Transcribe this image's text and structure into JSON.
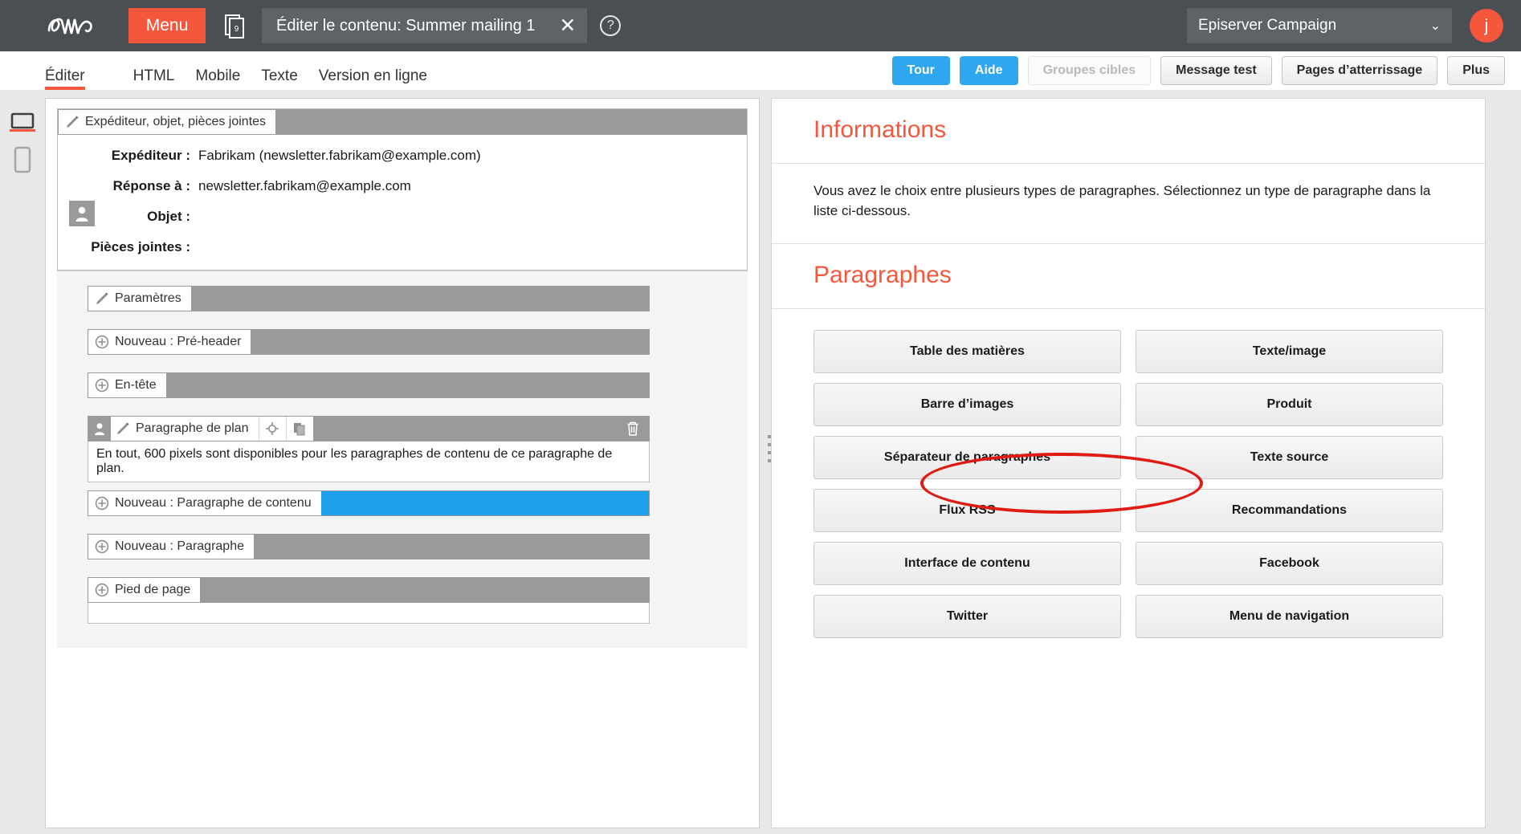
{
  "topbar": {
    "logo_name": "episerver-logo",
    "menu_label": "Menu",
    "doc_icon_badge": "9",
    "tab_title": "Éditer le contenu: Summer mailing 1",
    "tab_close": "✕",
    "help_label": "?",
    "account_label": "Episerver Campaign",
    "account_chevron": "⌄",
    "avatar_initial": "j",
    "accent_color": "#f4573b",
    "bar_color": "#4a4f54"
  },
  "subnav": {
    "tabs": [
      {
        "label": "Éditer",
        "active": true
      },
      {
        "label": "HTML",
        "active": false
      },
      {
        "label": "Mobile",
        "active": false
      },
      {
        "label": "Texte",
        "active": false
      },
      {
        "label": "Version en ligne",
        "active": false
      }
    ],
    "buttons": [
      {
        "label": "Tour",
        "style": "blue"
      },
      {
        "label": "Aide",
        "style": "blue"
      },
      {
        "label": "Groupes cibles",
        "style": "disabled"
      },
      {
        "label": "Message test",
        "style": "normal"
      },
      {
        "label": "Pages d’atterrissage",
        "style": "normal"
      },
      {
        "label": "Plus",
        "style": "normal"
      }
    ]
  },
  "device_rail": {
    "desktop_icon": "desktop-icon",
    "mobile_icon": "mobile-icon"
  },
  "editor": {
    "sender_block_label": "Expéditeur, objet, pièces jointes",
    "fields": [
      {
        "label": "Expéditeur :",
        "value": "Fabrikam (newsletter.fabrikam@example.com)"
      },
      {
        "label": "Réponse à :",
        "value": "newsletter.fabrikam@example.com"
      },
      {
        "label": "Objet :",
        "value": ""
      },
      {
        "label": "Pièces jointes :",
        "value": ""
      }
    ],
    "nodes": [
      {
        "label": "Paramètres",
        "icon": "brush-icon",
        "fill": "gray"
      },
      {
        "label": "Nouveau : Pré-header",
        "icon": "plus-icon",
        "fill": "gray"
      },
      {
        "label": "En-tête",
        "icon": "plus-icon",
        "fill": "gray"
      }
    ],
    "plan_node": {
      "label": "Paragraphe de plan",
      "person_icon": "person-icon",
      "brush_icon": "brush-icon",
      "target_icon": "target-icon",
      "copy_icon": "copy-icon",
      "trash_icon": "trash-icon",
      "note": "En tout, 600 pixels sont disponibles pour les paragraphes de contenu de ce paragraphe de plan.",
      "children": [
        {
          "label": "Nouveau : Paragraphe de contenu",
          "icon": "plus-icon",
          "fill": "blue"
        }
      ]
    },
    "tail_nodes": [
      {
        "label": "Nouveau : Paragraphe",
        "icon": "plus-icon",
        "fill": "gray"
      },
      {
        "label": "Pied de page",
        "icon": "plus-icon",
        "fill": "gray"
      }
    ]
  },
  "info_panel": {
    "info_title": "Informations",
    "info_text": "Vous avez le choix entre plusieurs types de paragraphes. Sélectionnez un type de paragraphe dans la liste ci-dessous.",
    "paragraphs_title": "Paragraphes",
    "paragraph_buttons": [
      "Table des matières",
      "Texte/image",
      "Barre d’images",
      "Produit",
      "Séparateur de paragraphes",
      "Texte source",
      "Flux RSS",
      "Recommandations",
      "Interface de contenu",
      "Facebook",
      "Twitter",
      "Menu de navigation"
    ],
    "highlighted_button": "Texte source",
    "highlight_color": "#e01b14"
  }
}
